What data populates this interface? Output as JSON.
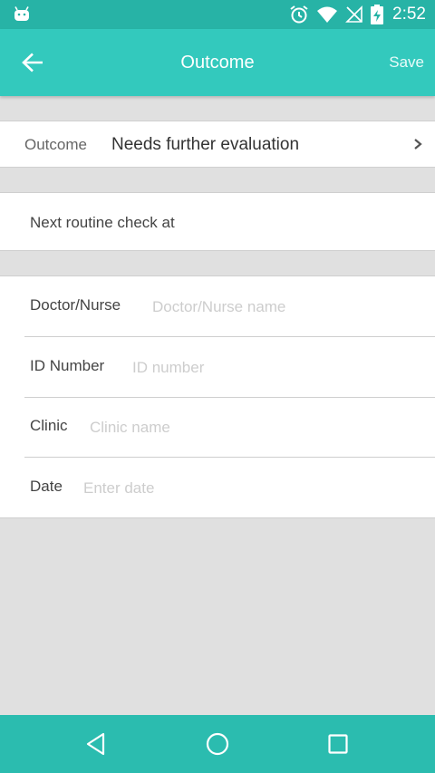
{
  "status_bar": {
    "time": "2:52",
    "icons": [
      "android-icon",
      "alarm-icon",
      "wifi-icon",
      "no-signal-icon",
      "battery-charging-icon"
    ]
  },
  "app_bar": {
    "title": "Outcome",
    "save_label": "Save",
    "back_icon": "back-arrow-icon"
  },
  "outcome": {
    "label": "Outcome",
    "value": "Needs further evaluation",
    "icon": "chevron-right-icon"
  },
  "next_check": {
    "label": "Next routine check at"
  },
  "fields": [
    {
      "label": "Doctor/Nurse",
      "placeholder": "Doctor/Nurse name",
      "value": ""
    },
    {
      "label": "ID Number",
      "placeholder": "ID number",
      "value": ""
    },
    {
      "label": "Clinic",
      "placeholder": "Clinic name",
      "value": ""
    },
    {
      "label": "Date",
      "placeholder": "Enter date",
      "value": ""
    }
  ],
  "nav_bar": {
    "icons": [
      "back-triangle-icon",
      "home-circle-icon",
      "recents-square-icon"
    ]
  },
  "colors": {
    "app_bar": "#33c9bd",
    "status_bar": "#27b3a6",
    "nav_bar": "#2bbcaf",
    "background": "#e0e0e0",
    "placeholder": "#cdcdcd"
  }
}
